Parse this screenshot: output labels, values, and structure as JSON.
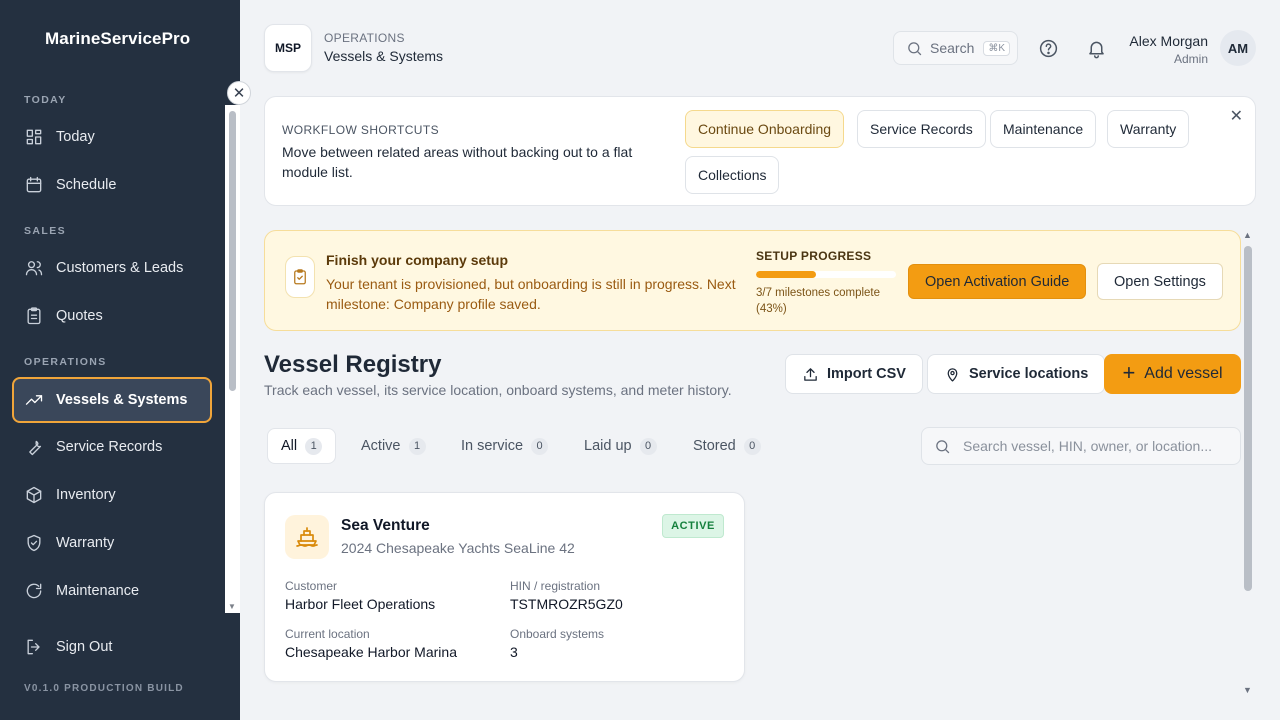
{
  "app": {
    "brand": "MarineServicePro",
    "version": "V0.1.0 PRODUCTION BUILD"
  },
  "sidebar": {
    "sections": {
      "today": "TODAY",
      "sales": "SALES",
      "operations": "OPERATIONS"
    },
    "items": [
      {
        "label": "Today",
        "icon": "grid-icon"
      },
      {
        "label": "Schedule",
        "icon": "calendar-icon"
      },
      {
        "label": "Customers & Leads",
        "icon": "users-icon"
      },
      {
        "label": "Quotes",
        "icon": "clipboard-icon"
      },
      {
        "label": "Vessels & Systems",
        "icon": "trending-icon",
        "active": true
      },
      {
        "label": "Service Records",
        "icon": "wrench-icon"
      },
      {
        "label": "Inventory",
        "icon": "box-icon"
      },
      {
        "label": "Warranty",
        "icon": "shield-icon"
      },
      {
        "label": "Maintenance",
        "icon": "refresh-icon"
      }
    ],
    "sign_out": "Sign Out",
    "collapse_symbol": "✕"
  },
  "header": {
    "logo": "MSP",
    "section": "OPERATIONS",
    "page": "Vessels & Systems",
    "search_label": "Search",
    "search_shortcut": "⌘K",
    "user": {
      "name": "Alex Morgan",
      "role": "Admin",
      "initials": "AM"
    }
  },
  "shortcuts": {
    "eyebrow": "WORKFLOW SHORTCUTS",
    "description": "Move between related areas without backing out to a flat module list.",
    "chips": [
      "Continue Onboarding",
      "Service Records",
      "Maintenance",
      "Warranty",
      "Collections"
    ],
    "close": "✕"
  },
  "setup": {
    "title": "Finish your company setup",
    "description": "Your tenant is provisioned, but onboarding is still in progress. Next milestone: Company profile saved.",
    "progress_label": "SETUP PROGRESS",
    "progress_text": "3/7 milestones complete (43%)",
    "progress_fraction": 0.43,
    "guide_button": "Open Activation Guide",
    "settings_button": "Open Settings"
  },
  "registry": {
    "title": "Vessel Registry",
    "subtitle": "Track each vessel, its service location, onboard systems, and meter history.",
    "import_button": "Import CSV",
    "locations_button": "Service locations",
    "add_button": "Add vessel",
    "tabs": [
      {
        "label": "All",
        "count": "1"
      },
      {
        "label": "Active",
        "count": "1"
      },
      {
        "label": "In service",
        "count": "0"
      },
      {
        "label": "Laid up",
        "count": "0"
      },
      {
        "label": "Stored",
        "count": "0"
      }
    ],
    "search_placeholder": "Search vessel, HIN, owner, or location...",
    "search_value": ""
  },
  "vessel": {
    "name": "Sea Venture",
    "model": "2024 Chesapeake Yachts SeaLine 42",
    "status": "ACTIVE",
    "customer_label": "Customer",
    "customer": "Harbor Fleet Operations",
    "hin_label": "HIN / registration",
    "hin": "TSTMROZR5GZ0",
    "location_label": "Current location",
    "location": "Chesapeake Harbor Marina",
    "systems_label": "Onboard systems",
    "systems": "3"
  },
  "colors": {
    "sidebar_bg": "#243040",
    "accent": "#f39c12",
    "active_badge": "#15803d"
  }
}
